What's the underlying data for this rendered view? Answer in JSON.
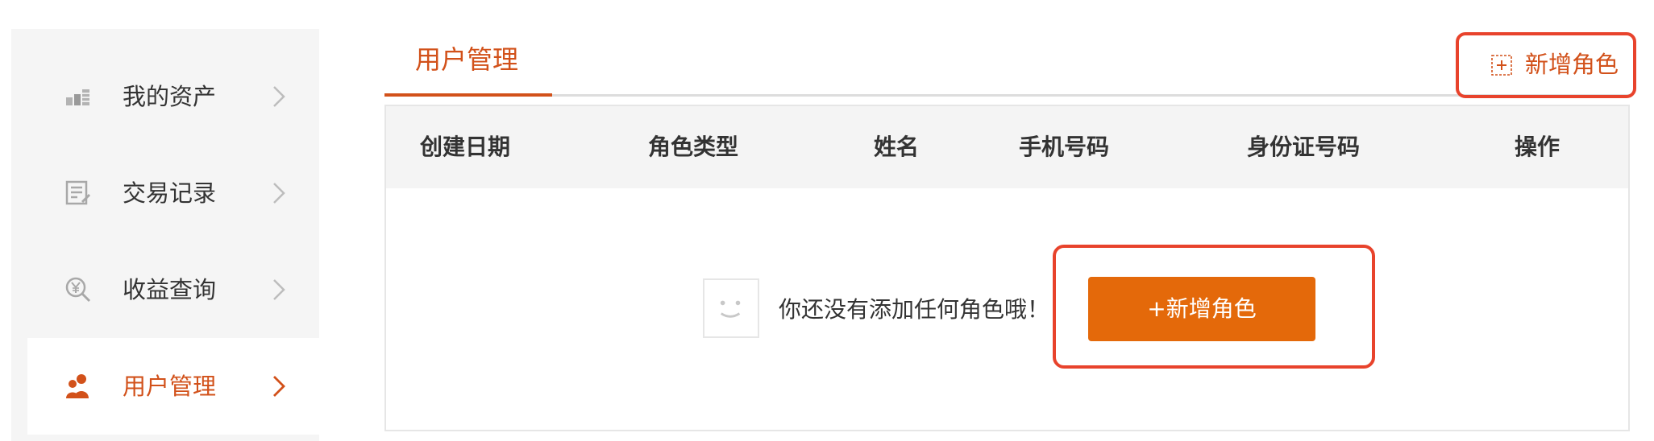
{
  "sidebar": {
    "items": [
      {
        "label": "我的资产",
        "icon": "coins-icon",
        "active": false
      },
      {
        "label": "交易记录",
        "icon": "record-list-icon",
        "active": false
      },
      {
        "label": "收益查询",
        "icon": "yen-search-icon",
        "active": false
      },
      {
        "label": "用户管理",
        "icon": "users-icon",
        "active": true
      }
    ]
  },
  "tabs": {
    "active_label": "用户管理",
    "add_role_label": "新增角色"
  },
  "table": {
    "headers": [
      "创建日期",
      "角色类型",
      "姓名",
      "手机号码",
      "身份证号码",
      "操作"
    ],
    "empty_text": "你还没有添加任何角色哦！",
    "add_button_label": "+新增角色"
  },
  "colors": {
    "accent": "#d2511a",
    "button": "#e4690a",
    "highlight": "#e8432c",
    "sidebar_bg": "#f5f5f5",
    "header_bg": "#f4f4f4"
  }
}
